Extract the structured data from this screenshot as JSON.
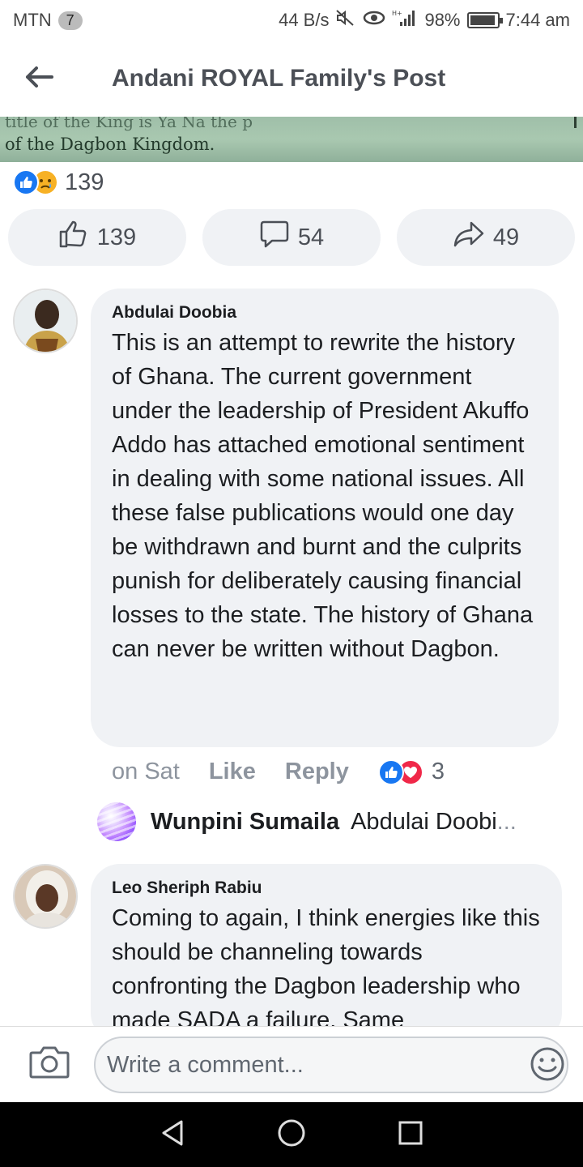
{
  "status_bar": {
    "carrier": "MTN",
    "carrier_badge": "7",
    "net_speed": "44 B/s",
    "battery_percent": "98%",
    "time": "7:44 am"
  },
  "header": {
    "title": "Andani ROYAL Family's Post"
  },
  "post_image": {
    "line1": "title of the King is Ya Na the p",
    "line2": "of the Dagbon Kingdom."
  },
  "reactions": {
    "count": "139",
    "icons": [
      "like-icon",
      "sad-icon"
    ]
  },
  "actions": {
    "like_count": "139",
    "comment_count": "54",
    "share_count": "49"
  },
  "comments": [
    {
      "author": "Abdulai Doobia",
      "text": "This is an attempt to rewrite the history of Ghana.  The current government under the leadership of President Akuffo Addo has attached emotional sentiment in dealing with some national issues.  All these false publications would one day be withdrawn and burnt and the culprits punish for deliberately causing financial losses to the state.  The history of Ghana can never be written without Dagbon.",
      "time": "on Sat",
      "like_label": "Like",
      "reply_label": "Reply",
      "reaction_count": "3"
    },
    {
      "author": "Leo Sheriph Rabiu",
      "text": "Coming to again, I think energies like this should be channeling towards confronting the Dagbon leadership who made SADA a failure. Same"
    }
  ],
  "reply_preview": {
    "name": "Wunpini Sumaila",
    "text": "Abdulai Doobi",
    "ellipsis": "..."
  },
  "composer": {
    "placeholder": "Write a comment..."
  },
  "colors": {
    "accent": "#1877f2",
    "bubble": "#f0f2f5",
    "muted": "#8d949e"
  }
}
